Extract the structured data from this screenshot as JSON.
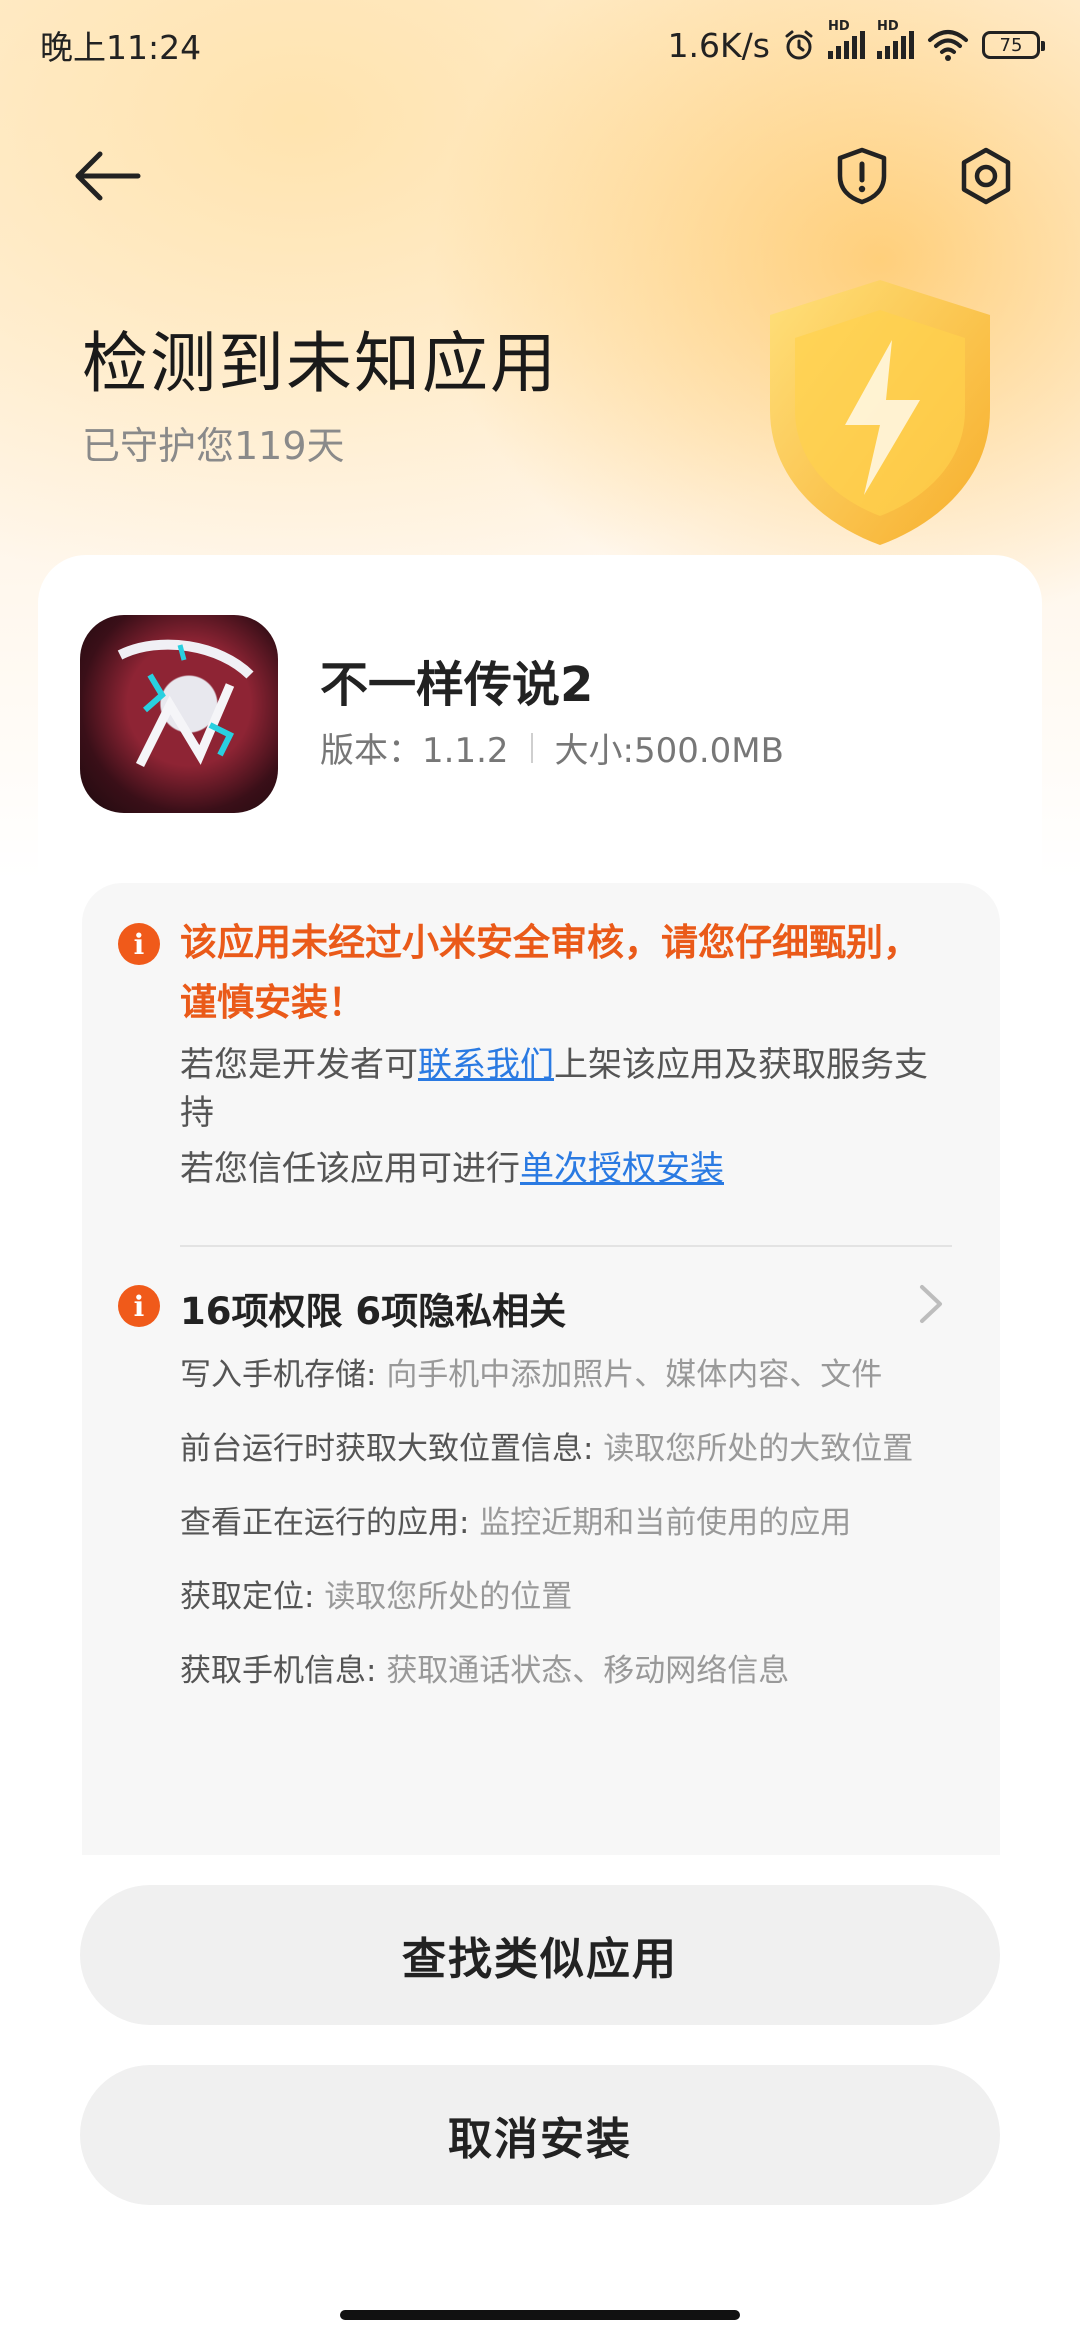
{
  "status": {
    "time": "晚上11:24",
    "net_speed": "1.6K/s",
    "signal_badge_1": "HD",
    "signal_badge_2": "HD",
    "battery": "75"
  },
  "header": {
    "title": "检测到未知应用",
    "subtitle": "已守护您119天"
  },
  "app": {
    "name": "不一样传说2",
    "version": "版本：1.1.2",
    "size": "大小:500.0MB"
  },
  "warning": {
    "title": "该应用未经过小米安全审核，请您仔细甄别，谨慎安装！",
    "dev_prefix": "若您是开发者可",
    "dev_link": "联系我们",
    "dev_suffix": "上架该应用及获取服务支持",
    "trust_prefix": "若您信任该应用可进行",
    "trust_link": "单次授权安装"
  },
  "permissions": {
    "title": "16项权限 6项隐私相关",
    "items": [
      {
        "name": "写入手机存储: ",
        "desc": "向手机中添加照片、媒体内容、文件"
      },
      {
        "name": "前台运行时获取大致位置信息: ",
        "desc": "读取您所处的大致位置"
      },
      {
        "name": "查看正在运行的应用: ",
        "desc": "监控近期和当前使用的应用"
      },
      {
        "name": "获取定位: ",
        "desc": "读取您所处的位置"
      },
      {
        "name": "获取手机信息: ",
        "desc": "获取通话状态、移动网络信息"
      }
    ]
  },
  "buttons": {
    "find_similar": "查找类似应用",
    "cancel_install": "取消安装"
  },
  "colors": {
    "warning_orange": "#ea5a19",
    "link_blue": "#2a7ae2",
    "accent_gold": "#ffc25c"
  },
  "icons": {
    "back": "back-arrow-icon",
    "report": "shield-exclamation-icon",
    "settings": "gear-icon",
    "info": "info-icon",
    "chevron": "chevron-right-icon"
  }
}
